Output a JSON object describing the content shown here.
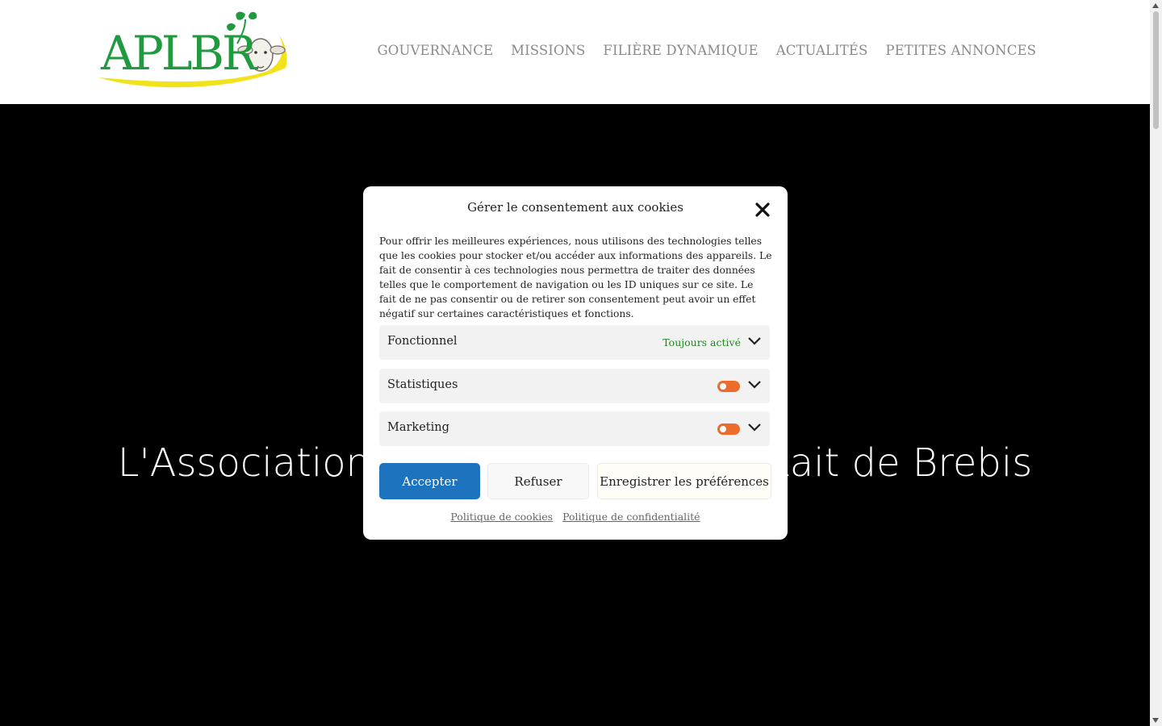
{
  "logo": {
    "text": "APLBR"
  },
  "nav": {
    "items": [
      "GOUVERNANCE",
      "MISSIONS",
      "FILIÈRE DYNAMIQUE",
      "ACTUALITÉS",
      "PETITES ANNONCES"
    ]
  },
  "hero": {
    "title": "L'Association des Producteurs de Lait de Brebis"
  },
  "cookie_modal": {
    "title": "Gérer le consentement aux cookies",
    "message": "Pour offrir les meilleures expériences, nous utilisons des technologies telles que les cookies pour stocker et/ou accéder aux informations des appareils. Le fait de consentir à ces technologies nous permettra de traiter des données telles que le comportement de navigation ou les ID uniques sur ce site. Le fait de ne pas consentir ou de retirer son consentement peut avoir un effet négatif sur certaines caractéristiques et fonctions.",
    "categories": [
      {
        "label": "Fonctionnel",
        "status": "Toujours activé"
      },
      {
        "label": "Statistiques"
      },
      {
        "label": "Marketing"
      }
    ],
    "buttons": {
      "accept": "Accepter",
      "deny": "Refuser",
      "preferences": "Enregistrer les préférences"
    },
    "links": {
      "cookie_policy": "Politique de cookies",
      "privacy_policy": "Politique de confidentialité"
    }
  },
  "colors": {
    "accent": "#1e73be",
    "toggle": "#eb6c2c",
    "always_on": "#1b8a1b",
    "logo_green": "#1f9a3f",
    "logo_yellow": "#f2e21a"
  }
}
